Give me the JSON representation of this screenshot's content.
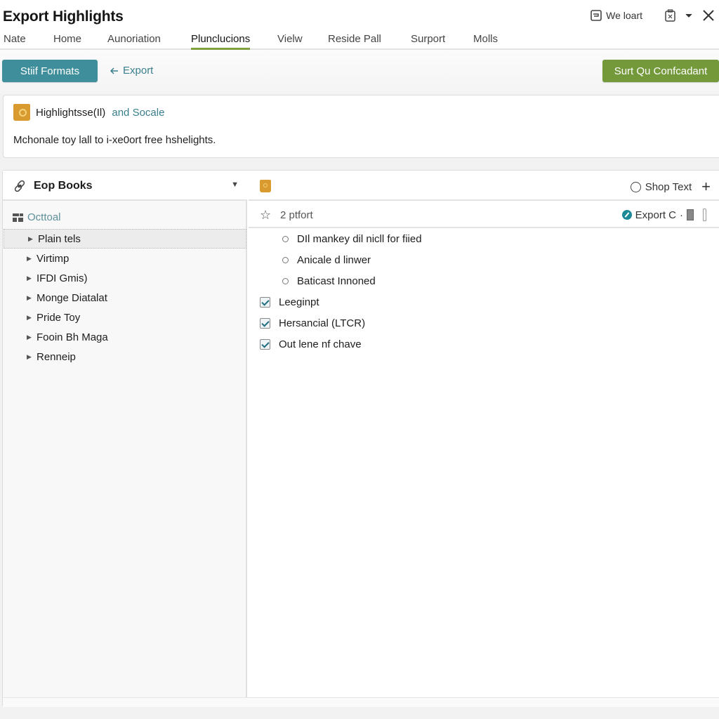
{
  "app": {
    "title": "Export Highlights",
    "title_actions": {
      "weloart_label": "We loart",
      "weloart_icon": "window-icon",
      "clipboard_icon": "clipboard-icon",
      "dropdown_icon": "chevron-down-icon",
      "close_icon": "close-icon"
    }
  },
  "menu": {
    "items": [
      {
        "label": "Nate",
        "active": false
      },
      {
        "label": "Home",
        "active": false
      },
      {
        "label": "Aunoriation",
        "active": false
      },
      {
        "label": "Plunclucions",
        "active": true
      },
      {
        "label": "Vielw",
        "active": false
      },
      {
        "label": "Reside Pall",
        "active": false
      },
      {
        "label": "Surport",
        "active": false
      },
      {
        "label": "Molls",
        "active": false
      }
    ]
  },
  "toolbar": {
    "formats_label": "Stiif Formats",
    "export_label": "Export",
    "confirm_label": "Surt Qu Confcadant",
    "colors": {
      "formats": "#3f8e9c",
      "confirm": "#74993a"
    }
  },
  "info": {
    "title": "Highlightsse(Il)",
    "title_accent": "and Socale",
    "description": "Mchonale toy lall to i-xe0ort free hshelights."
  },
  "sidebar": {
    "header_label": "Eop Books",
    "section_label": "Octtoal",
    "items": [
      {
        "label": "Plain tels",
        "selected": true
      },
      {
        "label": "Virtimp",
        "selected": false
      },
      {
        "label": "IFDI Gmis)",
        "selected": false
      },
      {
        "label": "Monge Diatalat",
        "selected": false
      },
      {
        "label": "Pride Toy",
        "selected": false
      },
      {
        "label": "Fooin Bh Maga",
        "selected": false
      },
      {
        "label": "Renneip",
        "selected": false
      }
    ]
  },
  "content": {
    "shop_text_label": "Shop Text",
    "count_label": "2 ptfort",
    "export_c_label": "Export C",
    "radio_options": [
      {
        "label": "DIl mankey dil nicll for fiied"
      },
      {
        "label": "Anicale d linwer"
      },
      {
        "label": "Baticast Innoned"
      }
    ],
    "check_options": [
      {
        "label": "Leeginpt",
        "checked": true
      },
      {
        "label": "Hersancial (LTCR)",
        "checked": true
      },
      {
        "label": "Out lene nf chave",
        "checked": true
      }
    ]
  }
}
